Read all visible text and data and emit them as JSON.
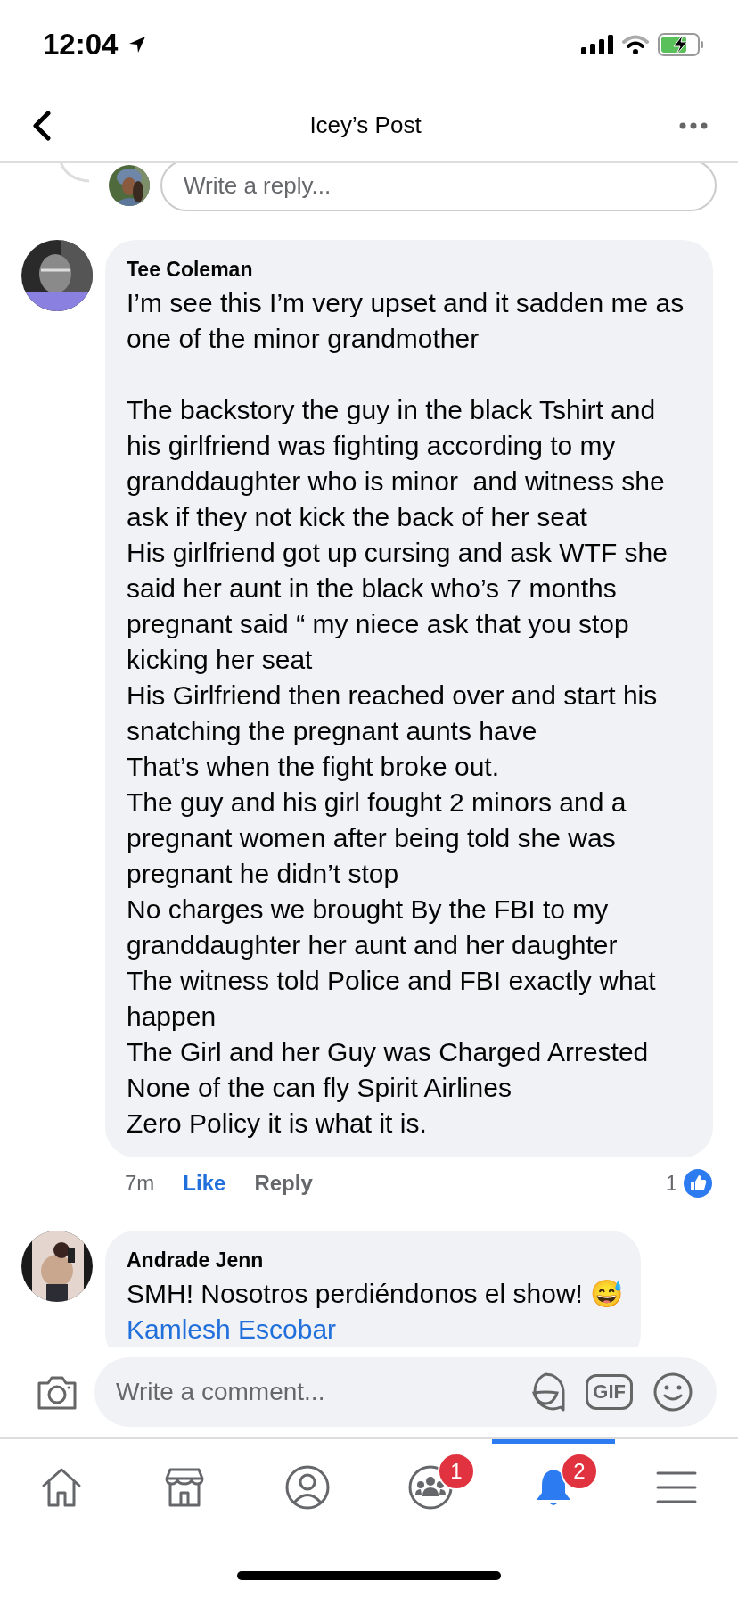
{
  "status_bar": {
    "time": "12:04"
  },
  "header": {
    "title": "Icey’s Post"
  },
  "reply_box": {
    "placeholder": "Write a reply..."
  },
  "comments": [
    {
      "author": "Tee Coleman",
      "paragraphs": [
        "I’m see this I’m very upset and it sadden me as one of the minor grandmother"
      ],
      "paragraphs_after_gap": [
        "The backstory the guy in the black Tshirt and his girlfriend was fighting according to my granddaughter who is minor  and witness she ask if they not kick the back of her seat",
        "His girlfriend got up cursing and ask WTF she said her aunt in the black who’s 7 months pregnant said “ my niece ask that you stop kicking her seat",
        "His Girlfriend then reached over and start his snatching the pregnant aunts have",
        "That’s when the fight broke out.",
        "The guy and his girl fought 2 minors and a pregnant women after being told she was pregnant he didn’t stop",
        "No charges we brought By the FBI to my granddaughter her aunt and her daughter",
        "The witness told Police and FBI exactly what happen",
        "The Girl and her Guy was Charged Arrested",
        "None of the can fly Spirit Airlines",
        "Zero Policy it is what it is."
      ],
      "time": "7m",
      "like": "Like",
      "liked": true,
      "reply": "Reply",
      "reactions": "1"
    },
    {
      "author": "Andrade Jenn",
      "paragraphs": [
        "SMH! Nosotros perdiéndonos el show! 😅"
      ],
      "mention": "Kamlesh Escobar"
    }
  ],
  "composer": {
    "placeholder": "Write a comment...",
    "gif": "GIF"
  },
  "tabs": [
    {
      "kind": "home",
      "selected": false
    },
    {
      "kind": "market",
      "selected": false
    },
    {
      "kind": "profile",
      "selected": false
    },
    {
      "kind": "groups",
      "selected": false,
      "badge": "1"
    },
    {
      "kind": "bell",
      "selected": true,
      "badge": "2"
    },
    {
      "kind": "menu",
      "selected": false
    }
  ]
}
